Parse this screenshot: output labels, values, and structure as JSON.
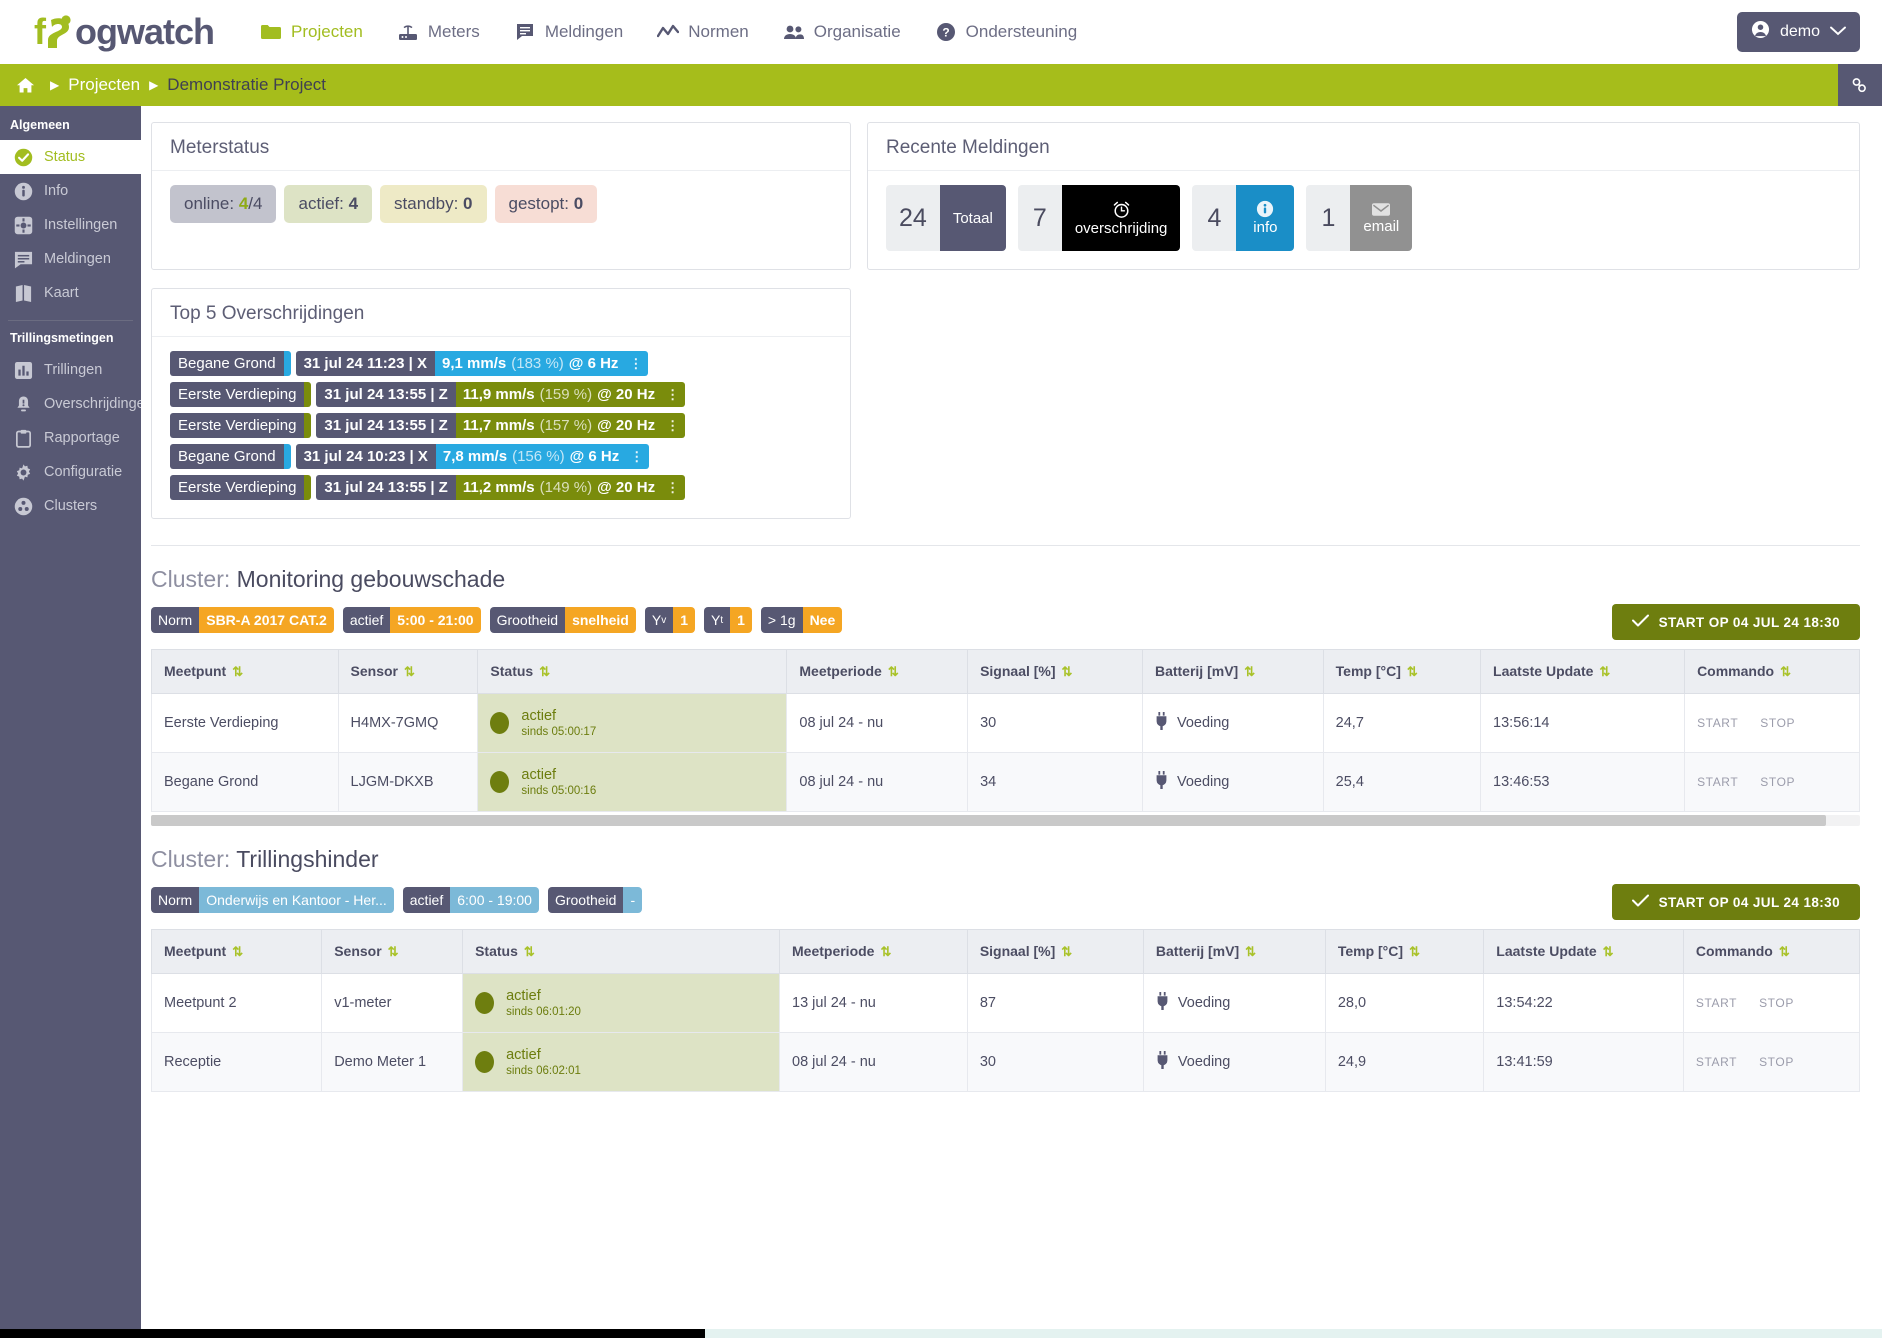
{
  "brand": {
    "name_part1": "f",
    "name_part2": "ogwatch"
  },
  "topnav": {
    "items": [
      {
        "label": "Projecten",
        "icon": "folder-icon",
        "active": true
      },
      {
        "label": "Meters",
        "icon": "router-icon",
        "active": false
      },
      {
        "label": "Meldingen",
        "icon": "message-icon",
        "active": false
      },
      {
        "label": "Normen",
        "icon": "chart-line-icon",
        "active": false
      },
      {
        "label": "Organisatie",
        "icon": "users-icon",
        "active": false
      },
      {
        "label": "Ondersteuning",
        "icon": "question-circle-icon",
        "active": false
      }
    ],
    "user": {
      "label": "demo",
      "icon": "user-circle-icon",
      "chevron": "chevron-down-icon"
    }
  },
  "breadcrumb": {
    "home_icon": "home-icon",
    "items": [
      "Projecten",
      "Demonstratie Project"
    ],
    "link_button_icon": "link-icon"
  },
  "sidebar": {
    "group1_title": "Algemeen",
    "group1_items": [
      {
        "label": "Status",
        "icon": "check-circle-icon",
        "active": true
      },
      {
        "label": "Info",
        "icon": "info-circle-icon",
        "active": false
      },
      {
        "label": "Instellingen",
        "icon": "gear-square-icon",
        "active": false
      },
      {
        "label": "Meldingen",
        "icon": "message-icon",
        "active": false
      },
      {
        "label": "Kaart",
        "icon": "map-icon",
        "active": false
      }
    ],
    "group2_title": "Trillingsmetingen",
    "group2_items": [
      {
        "label": "Trillingen",
        "icon": "bar-chart-icon",
        "active": false
      },
      {
        "label": "Overschrijdingen",
        "icon": "alarm-bell-icon",
        "active": false
      },
      {
        "label": "Rapportage",
        "icon": "clipboard-icon",
        "active": false
      },
      {
        "label": "Configuratie",
        "icon": "gear-icon",
        "active": false
      },
      {
        "label": "Clusters",
        "icon": "clusters-icon",
        "active": false
      }
    ]
  },
  "meterstatus": {
    "title": "Meterstatus",
    "pills": [
      {
        "prefix": "online: ",
        "value": "4",
        "suffix": "/4",
        "kind": "online"
      },
      {
        "prefix": "actief: ",
        "value": "4",
        "suffix": "",
        "kind": "actief"
      },
      {
        "prefix": "standby: ",
        "value": "0",
        "suffix": "",
        "kind": "standby"
      },
      {
        "prefix": "gestopt: ",
        "value": "0",
        "suffix": "",
        "kind": "gestopt"
      }
    ]
  },
  "meldingen": {
    "title": "Recente Meldingen",
    "badges": [
      {
        "count": "24",
        "label": "Totaal",
        "icon": "",
        "kind": "totaal"
      },
      {
        "count": "7",
        "label": "overschrijding",
        "icon": "alarm-clock-icon",
        "kind": "overschrijding"
      },
      {
        "count": "4",
        "label": "info",
        "icon": "info-circle-icon",
        "kind": "info"
      },
      {
        "count": "1",
        "label": "email",
        "icon": "envelope-icon",
        "kind": "email"
      }
    ]
  },
  "top5": {
    "title": "Top 5 Overschrijdingen",
    "rows": [
      {
        "meetpunt": "Begane Grond",
        "datetime": "31 jul 24 11:23 | X",
        "value": "9,1 mm/s",
        "pct": "(183 %)",
        "freq": "@ 6 Hz",
        "color": "#28a9e1"
      },
      {
        "meetpunt": "Eerste Verdieping",
        "datetime": "31 jul 24 13:55 | Z",
        "value": "11,9 mm/s",
        "pct": "(159 %)",
        "freq": "@ 20 Hz",
        "color": "#7a8c0c"
      },
      {
        "meetpunt": "Eerste Verdieping",
        "datetime": "31 jul 24 13:55 | Z",
        "value": "11,7 mm/s",
        "pct": "(157 %)",
        "freq": "@ 20 Hz",
        "color": "#7a8c0c"
      },
      {
        "meetpunt": "Begane Grond",
        "datetime": "31 jul 24 10:23 | X",
        "value": "7,8 mm/s",
        "pct": "(156 %)",
        "freq": "@ 6 Hz",
        "color": "#28a9e1"
      },
      {
        "meetpunt": "Eerste Verdieping",
        "datetime": "31 jul 24 13:55 | Z",
        "value": "11,2 mm/s",
        "pct": "(149 %)",
        "freq": "@ 20 Hz",
        "color": "#7a8c0c"
      }
    ]
  },
  "table_headers": [
    "Meetpunt",
    "Sensor",
    "Status",
    "Meetperiode",
    "Signaal [%]",
    "Batterij [mV]",
    "Temp [°C]",
    "Laatste Update",
    "Commando"
  ],
  "clusters": [
    {
      "prefix": "Cluster: ",
      "name": "Monitoring gebouwschade",
      "start_button": "START OP 04 JUL 24 18:30",
      "start_icon": "check-icon",
      "tag_style": "amber",
      "tags": [
        {
          "k": "Norm",
          "v": "SBR-A 2017 CAT.2"
        },
        {
          "k": "actief",
          "v": "5:00 - 21:00"
        },
        {
          "k": "Grootheid",
          "v": "snelheid"
        },
        {
          "k": "Yv",
          "v": "1",
          "sub": "v"
        },
        {
          "k": "Yt",
          "v": "1",
          "sub": "t"
        },
        {
          "k": "> 1g",
          "v": "Nee"
        }
      ],
      "rows": [
        {
          "meetpunt": "Eerste Verdieping",
          "sensor": "H4MX-7GMQ",
          "status": "actief",
          "since": "sinds 05:00:17",
          "meetperiode": "08 jul 24 - nu",
          "signaal": "30",
          "batterij": "Voeding",
          "temp": "24,7",
          "update": "13:56:14",
          "start": "START",
          "stop": "STOP"
        },
        {
          "meetpunt": "Begane Grond",
          "sensor": "LJGM-DKXB",
          "status": "actief",
          "since": "sinds 05:00:16",
          "meetperiode": "08 jul 24 - nu",
          "signaal": "34",
          "batterij": "Voeding",
          "temp": "25,4",
          "update": "13:46:53",
          "start": "START",
          "stop": "STOP"
        }
      ]
    },
    {
      "prefix": "Cluster: ",
      "name": "Trillingshinder",
      "start_button": "START OP 04 JUL 24 18:30",
      "start_icon": "check-icon",
      "tag_style": "blue",
      "tags": [
        {
          "k": "Norm",
          "v": "Onderwijs en Kantoor - Her..."
        },
        {
          "k": "actief",
          "v": "6:00 - 19:00"
        },
        {
          "k": "Grootheid",
          "v": "-"
        }
      ],
      "rows": [
        {
          "meetpunt": "Meetpunt 2",
          "sensor": "v1-meter",
          "status": "actief",
          "since": "sinds 06:01:20",
          "meetperiode": "13 jul 24 - nu",
          "signaal": "87",
          "batterij": "Voeding",
          "temp": "28,0",
          "update": "13:54:22",
          "start": "START",
          "stop": "STOP"
        },
        {
          "meetpunt": "Receptie",
          "sensor": "Demo Meter 1",
          "status": "actief",
          "since": "sinds 06:02:01",
          "meetperiode": "08 jul 24 - nu",
          "signaal": "30",
          "batterij": "Voeding",
          "temp": "24,9",
          "update": "13:41:59",
          "start": "START",
          "stop": "STOP"
        }
      ]
    }
  ],
  "colors": {
    "brand_green": "#a2bd20",
    "breadcrumb_green": "#a6bd1b",
    "sidebar_navy": "#575873",
    "amber": "#f5a623",
    "blue": "#7cb9d8",
    "olive": "#6e7e0f"
  }
}
